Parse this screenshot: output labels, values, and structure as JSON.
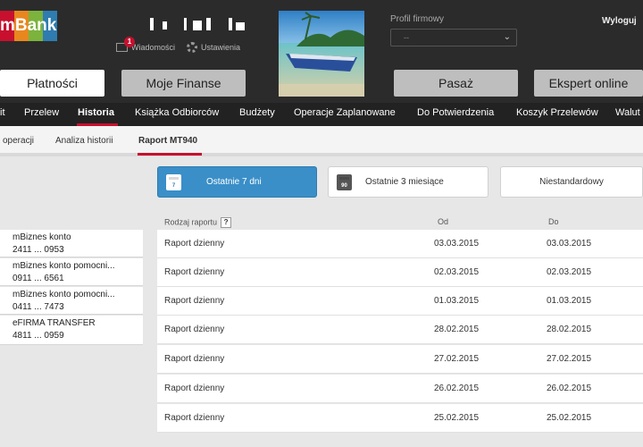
{
  "header": {
    "logo_text": "mBank",
    "messages_label": "Wiadomości",
    "messages_count": "1",
    "settings_label": "Ustawienia",
    "profile_label": "Profil firmowy",
    "profile_value": "--",
    "logout_label": "Wyloguj"
  },
  "main_nav": [
    "Płatności",
    "Moje Finanse",
    "Pasaż",
    "Ekspert online"
  ],
  "sub_nav": {
    "items": [
      "it",
      "Przelew",
      "Historia",
      "Książka Odbiorców",
      "Budżety",
      "Operacje Zaplanowane",
      "Do Potwierdzenia",
      "Koszyk Przelewów",
      "Walut"
    ],
    "active": "Historia"
  },
  "tabs": {
    "items": [
      "operacji",
      "Analiza historii",
      "Raport MT940"
    ],
    "active": "Raport MT940"
  },
  "periods": [
    {
      "label": "Ostatnie 7 dni",
      "icon_number": "7",
      "active": true
    },
    {
      "label": "Ostatnie 3 miesiące",
      "icon_number": "90",
      "active": false
    },
    {
      "label": "Niestandardowy",
      "active": false
    }
  ],
  "table": {
    "headers": [
      "Rodzaj raportu",
      "Od",
      "Do"
    ],
    "help": "?",
    "rows": [
      [
        "Raport dzienny",
        "03.03.2015",
        "03.03.2015"
      ],
      [
        "Raport dzienny",
        "02.03.2015",
        "02.03.2015"
      ],
      [
        "Raport dzienny",
        "01.03.2015",
        "01.03.2015"
      ],
      [
        "Raport dzienny",
        "28.02.2015",
        "28.02.2015"
      ],
      [
        "Raport dzienny",
        "27.02.2015",
        "27.02.2015"
      ],
      [
        "Raport dzienny",
        "26.02.2015",
        "26.02.2015"
      ],
      [
        "Raport dzienny",
        "25.02.2015",
        "25.02.2015"
      ]
    ]
  },
  "accounts": [
    {
      "name": "mBiznes konto",
      "number": "2411 ... 0953"
    },
    {
      "name": "mBiznes konto pomocni...",
      "number": "0911 ... 6561"
    },
    {
      "name": "mBiznes konto pomocni...",
      "number": "0411 ... 7473"
    },
    {
      "name": "eFIRMA TRANSFER",
      "number": "4811 ... 0959"
    }
  ],
  "colors": {
    "accent_red": "#c8102e",
    "active_blue": "#3a8fc8",
    "header_bg": "#2b2b2b"
  }
}
